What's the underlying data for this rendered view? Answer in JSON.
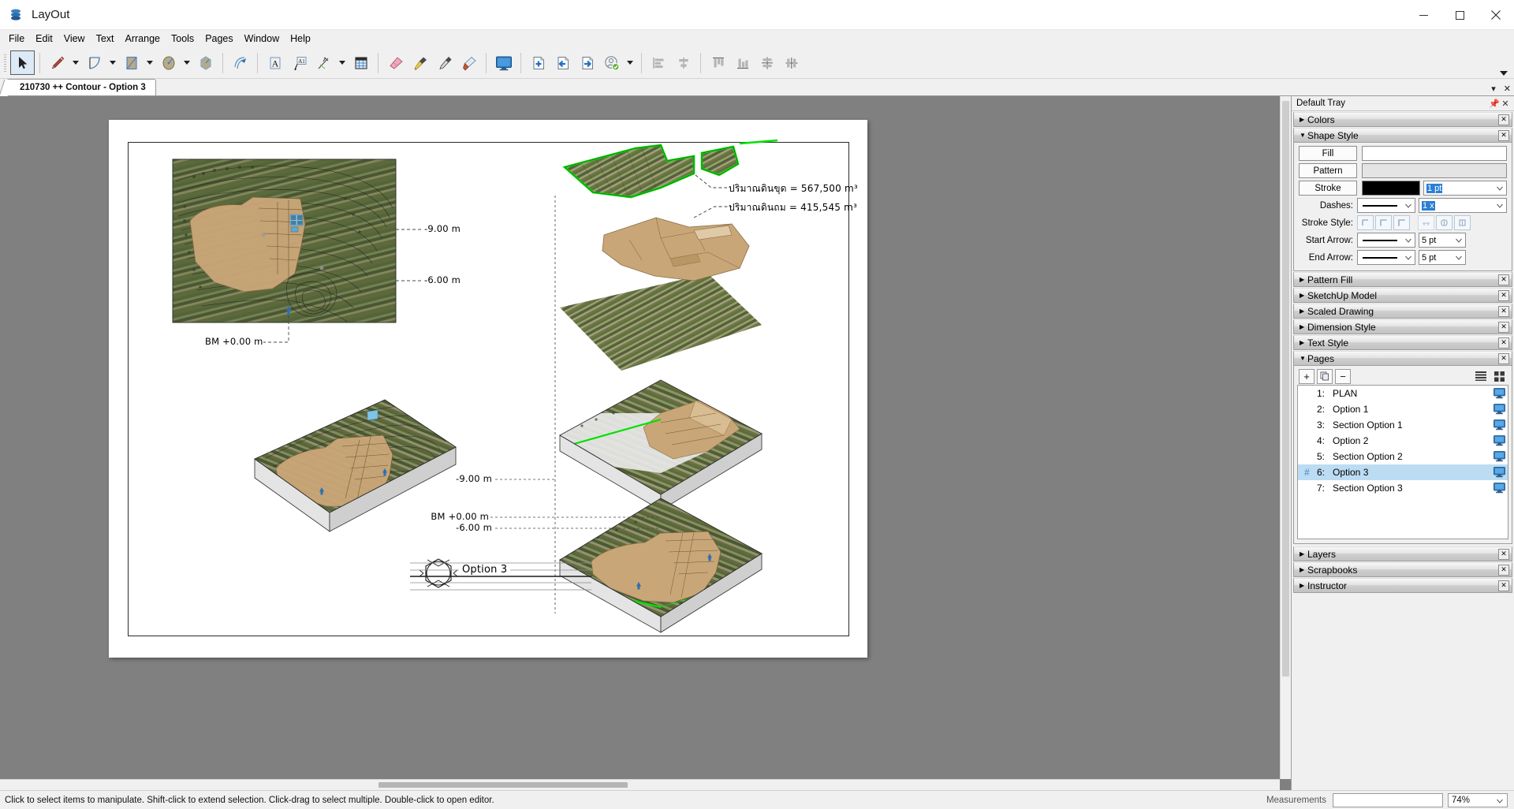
{
  "window": {
    "app_title": "LayOut",
    "app_icon": "layout-logo-icon",
    "minimize": "minimize-icon",
    "maximize": "maximize-icon",
    "close": "close-icon"
  },
  "menubar": {
    "items": [
      "File",
      "Edit",
      "View",
      "Text",
      "Arrange",
      "Tools",
      "Pages",
      "Window",
      "Help"
    ]
  },
  "toolbar": {
    "tools": [
      {
        "name": "select-tool",
        "icon": "arrow-cursor-icon",
        "selected": true,
        "caret": false
      },
      {
        "name": "line-tool",
        "icon": "pencil-icon",
        "selected": false,
        "caret": true
      },
      {
        "name": "arc-tool",
        "icon": "arc-icon",
        "selected": false,
        "caret": true
      },
      {
        "name": "rectangle-tool",
        "icon": "rectangle-icon",
        "selected": false,
        "caret": true
      },
      {
        "name": "circle-tool",
        "icon": "circle-icon",
        "selected": false,
        "caret": true
      },
      {
        "name": "polygon-tool",
        "icon": "polygon-icon",
        "selected": false,
        "caret": false
      },
      {
        "name": "offset-tool",
        "icon": "offset-icon",
        "selected": false,
        "caret": false
      },
      {
        "name": "text-tool",
        "icon": "text-a-icon",
        "selected": false,
        "caret": false
      },
      {
        "name": "label-tool",
        "icon": "label-a1-icon",
        "selected": false,
        "caret": false
      },
      {
        "name": "dimension-tool",
        "icon": "dimension-icon",
        "selected": false,
        "caret": true
      },
      {
        "name": "table-tool",
        "icon": "table-grid-icon",
        "selected": false,
        "caret": false
      },
      {
        "name": "eraser-tool",
        "icon": "eraser-icon",
        "selected": false,
        "caret": false
      },
      {
        "name": "style-tool",
        "icon": "eyedropper-icon",
        "selected": false,
        "caret": false
      },
      {
        "name": "split-tool",
        "icon": "split-knife-icon",
        "selected": false,
        "caret": false
      },
      {
        "name": "join-tool",
        "icon": "join-glue-icon",
        "selected": false,
        "caret": false
      },
      {
        "name": "start-presentation",
        "icon": "monitor-icon",
        "selected": false,
        "caret": false
      },
      {
        "name": "add-page",
        "icon": "page-add-icon",
        "selected": false,
        "caret": false
      },
      {
        "name": "previous-page",
        "icon": "page-previous-icon",
        "selected": false,
        "caret": false
      },
      {
        "name": "next-page",
        "icon": "page-next-icon",
        "selected": false,
        "caret": false
      },
      {
        "name": "account",
        "icon": "user-check-icon",
        "selected": false,
        "caret": true
      },
      {
        "name": "align-left",
        "icon": "align-left-icon",
        "selected": false,
        "caret": false
      },
      {
        "name": "align-center-horizontal",
        "icon": "align-center-h-icon",
        "selected": false,
        "caret": false
      },
      {
        "name": "align-top",
        "icon": "align-top-icon",
        "selected": false,
        "caret": false
      },
      {
        "name": "align-bottom",
        "icon": "align-bottom-icon",
        "selected": false,
        "caret": false
      },
      {
        "name": "distribute-vertical",
        "icon": "distribute-vertical-icon",
        "selected": false,
        "caret": false
      },
      {
        "name": "distribute-horizontal",
        "icon": "distribute-horizontal-icon",
        "selected": false,
        "caret": false
      }
    ],
    "overflow": "toolbar-overflow-icon"
  },
  "tabstrip": {
    "document_tab": "210730 ++ Contour - Option 3",
    "dropdown": "tab-list-icon",
    "close": "tab-close-icon"
  },
  "canvas": {
    "labels": [
      {
        "name": "elevation-label-minus9-plan",
        "text": "-9.00  m"
      },
      {
        "name": "elevation-label-minus6-plan",
        "text": "-6.00  m"
      },
      {
        "name": "benchmark-label-plan",
        "text": "BM +0.00 m"
      },
      {
        "name": "cut-volume-label",
        "text": "ปริมาณดินขุด  =  567,500 m³"
      },
      {
        "name": "fill-volume-label",
        "text": "ปริมาณดินถม  =  415,545 m³"
      },
      {
        "name": "elevation-label-minus9-iso",
        "text": "-9.00 m"
      },
      {
        "name": "benchmark-label-iso",
        "text": "BM +0.00 m"
      },
      {
        "name": "elevation-label-minus6-iso",
        "text": "-6.00 m"
      },
      {
        "name": "titleblock-label",
        "text": "Option 3"
      }
    ]
  },
  "tray": {
    "title": "Default Tray",
    "pin_icon": "pin-icon",
    "close_icon": "close-icon",
    "panels": [
      {
        "name": "colors",
        "title": "Colors",
        "expanded": false
      },
      {
        "name": "shape-style",
        "title": "Shape Style",
        "expanded": true
      },
      {
        "name": "pattern-fill",
        "title": "Pattern Fill",
        "expanded": false
      },
      {
        "name": "sketchup-model",
        "title": "SketchUp Model",
        "expanded": false
      },
      {
        "name": "scaled-drawing",
        "title": "Scaled Drawing",
        "expanded": false
      },
      {
        "name": "dimension-style",
        "title": "Dimension Style",
        "expanded": false
      },
      {
        "name": "text-style",
        "title": "Text Style",
        "expanded": false
      },
      {
        "name": "pages",
        "title": "Pages",
        "expanded": true
      },
      {
        "name": "layers",
        "title": "Layers",
        "expanded": false
      },
      {
        "name": "scrapbooks",
        "title": "Scrapbooks",
        "expanded": false
      },
      {
        "name": "instructor",
        "title": "Instructor",
        "expanded": false
      }
    ],
    "shape_style": {
      "fill_label": "Fill",
      "fill_color": "#ffffff",
      "pattern_label": "Pattern",
      "pattern_color": "#e4e4e4",
      "stroke_label": "Stroke",
      "stroke_color": "#000000",
      "stroke_width": "1 pt",
      "dashes_label": "Dashes:",
      "dashes_scale": "1 x",
      "stroke_style_label": "Stroke Style:",
      "start_arrow_label": "Start Arrow:",
      "start_arrow_size": "5 pt",
      "end_arrow_label": "End Arrow:",
      "end_arrow_size": "5 pt",
      "stroke_style_buttons": [
        "stroke-cap-flat-icon",
        "stroke-cap-round-icon",
        "stroke-cap-square-icon",
        "stroke-join-miter-icon",
        "stroke-join-round-icon",
        "stroke-join-bevel-icon"
      ]
    },
    "pages": {
      "add_label": "+",
      "duplicate_icon": "duplicate-page-icon",
      "remove_label": "−",
      "list_view_icon": "list-view-icon",
      "grid_view_icon": "grid-view-icon",
      "items": [
        {
          "num": "1:",
          "name": "PLAN",
          "active": false,
          "hash": ""
        },
        {
          "num": "2:",
          "name": "Option 1",
          "active": false,
          "hash": ""
        },
        {
          "num": "3:",
          "name": "Section Option 1",
          "active": false,
          "hash": ""
        },
        {
          "num": "4:",
          "name": "Option 2",
          "active": false,
          "hash": ""
        },
        {
          "num": "5:",
          "name": "Section Option 2",
          "active": false,
          "hash": ""
        },
        {
          "num": "6:",
          "name": "Option 3",
          "active": true,
          "hash": "#"
        },
        {
          "num": "7:",
          "name": "Section Option 3",
          "active": false,
          "hash": ""
        }
      ]
    }
  },
  "statusbar": {
    "message": "Click to select items to manipulate. Shift-click to extend selection. Click-drag to select multiple. Double-click to open editor.",
    "measurements_label": "Measurements",
    "measurements_value": "",
    "zoom_value": "74%"
  },
  "colors": {
    "accent": "#2a7fd4",
    "selection": "#bcdcf4",
    "canvas_bg": "#808080",
    "chrome_bg": "#f0f0f0",
    "contour_green": "#00e000"
  }
}
